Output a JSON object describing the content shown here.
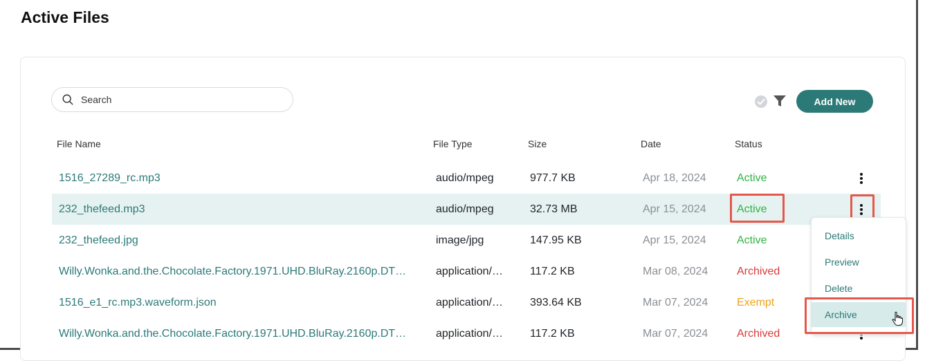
{
  "page": {
    "title": "Active Files"
  },
  "toolbar": {
    "search_placeholder": "Search",
    "add_label": "Add New",
    "check_icon": "check-circle-icon",
    "filter_icon": "filter-icon"
  },
  "table": {
    "headers": [
      "File Name",
      "File Type",
      "Size",
      "Date",
      "Status"
    ],
    "rows": [
      {
        "name": "1516_27289_rc.mp3",
        "type": "audio/mpeg",
        "size": "977.7 KB",
        "date": "Apr 18, 2024",
        "status": "Active"
      },
      {
        "name": "232_thefeed.mp3",
        "type": "audio/mpeg",
        "size": "32.73 MB",
        "date": "Apr 15, 2024",
        "status": "Active"
      },
      {
        "name": "232_thefeed.jpg",
        "type": "image/jpg",
        "size": "147.95 KB",
        "date": "Apr 15, 2024",
        "status": "Active"
      },
      {
        "name": "Willy.Wonka.and.the.Chocolate.Factory.1971.UHD.BluRay.2160p.DT…",
        "type": "application/o…",
        "size": "117.2 KB",
        "date": "Mar 08, 2024",
        "status": "Archived"
      },
      {
        "name": "1516_e1_rc.mp3.waveform.json",
        "type": "application/js…",
        "size": "393.64 KB",
        "date": "Mar 07, 2024",
        "status": "Exempt"
      },
      {
        "name": "Willy.Wonka.and.the.Chocolate.Factory.1971.UHD.BluRay.2160p.DT…",
        "type": "application/o…",
        "size": "117.2 KB",
        "date": "Mar 07, 2024",
        "status": "Archived"
      }
    ]
  },
  "context_menu": {
    "items": [
      "Details",
      "Preview",
      "Delete",
      "Archive"
    ],
    "active_item": "Archive"
  },
  "colors": {
    "accent": "#2b7a78",
    "active": "#2fb344",
    "archived": "#d93a3a",
    "exempt": "#f0a21a",
    "highlight": "#e5574a",
    "selected_row": "#e6f2f1"
  }
}
